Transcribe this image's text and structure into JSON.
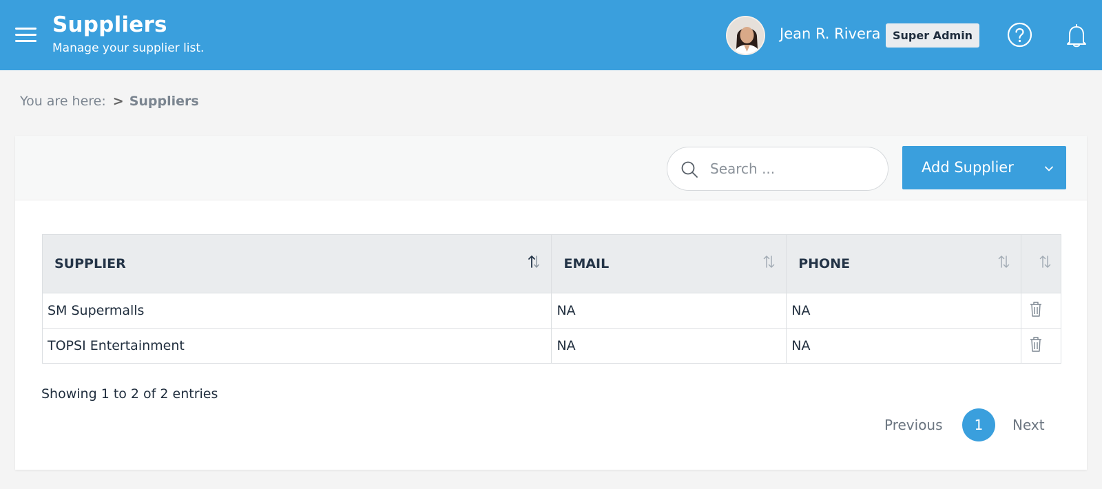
{
  "header": {
    "title": "Suppliers",
    "subtitle": "Manage your supplier list.",
    "user_name": "Jean R. Rivera",
    "role_badge": "Super Admin",
    "icons": [
      "menu-icon",
      "help-icon",
      "bell-icon"
    ]
  },
  "breadcrumb": {
    "prefix": "You are here:",
    "separator": ">",
    "current": "Suppliers"
  },
  "toolbar": {
    "search_placeholder": "Search ...",
    "add_button_label": "Add Supplier"
  },
  "table": {
    "columns": [
      "SUPPLIER",
      "EMAIL",
      "PHONE",
      ""
    ],
    "rows": [
      {
        "supplier": "SM Supermalls",
        "email": "NA",
        "phone": "NA"
      },
      {
        "supplier": "TOPSI Entertainment",
        "email": "NA",
        "phone": "NA"
      }
    ]
  },
  "footer": {
    "entries_info": "Showing 1 to 2 of 2 entries",
    "previous_label": "Previous",
    "current_page": "1",
    "next_label": "Next"
  },
  "colors": {
    "accent": "#3a9fdd",
    "header_bg": "#3a9fdd",
    "table_header_bg": "#eaecee"
  }
}
